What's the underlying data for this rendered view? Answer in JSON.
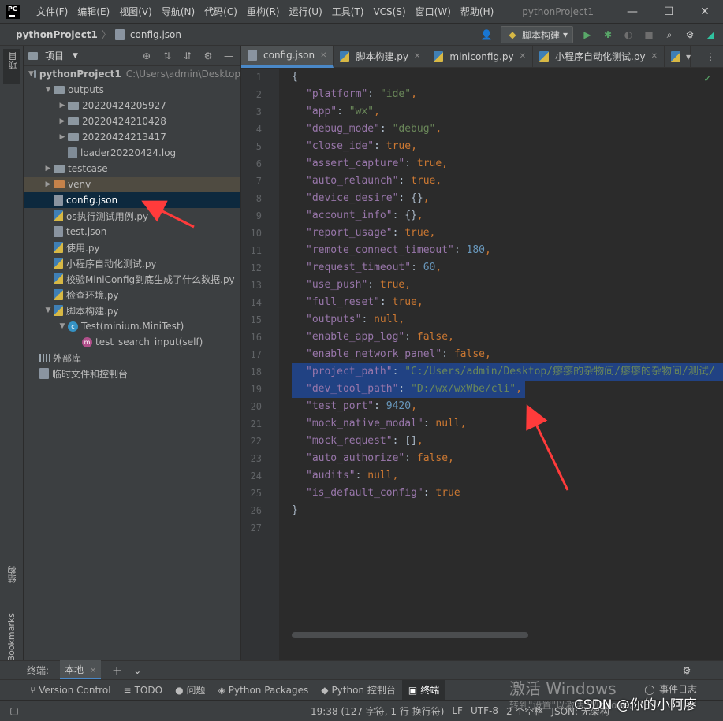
{
  "titlebar": {
    "logo": "PC",
    "menu": [
      "文件(F)",
      "编辑(E)",
      "视图(V)",
      "导航(N)",
      "代码(C)",
      "重构(R)",
      "运行(U)",
      "工具(T)",
      "VCS(S)",
      "窗口(W)",
      "帮助(H)"
    ],
    "window_title": "pythonProject1",
    "minimize": "—",
    "maximize": "☐",
    "close": "✕"
  },
  "navbar": {
    "project": "pythonProject1",
    "separator": "〉",
    "file": "config.json",
    "run_config": "脚本构建",
    "run_config_arrow": "▾"
  },
  "left_strip": {
    "project_label": "项目",
    "structure_label": "结构",
    "bookmarks_label": "Bookmarks"
  },
  "project_panel": {
    "title": "项目",
    "tree": [
      {
        "label": "pythonProject1",
        "hint": "C:\\Users\\admin\\Desktop",
        "depth": 0,
        "type": "folder",
        "expanded": true,
        "bold": true
      },
      {
        "label": "outputs",
        "depth": 1,
        "type": "folder",
        "expanded": true
      },
      {
        "label": "20220424205927",
        "depth": 2,
        "type": "folder",
        "expanded": false
      },
      {
        "label": "20220424210428",
        "depth": 2,
        "type": "folder",
        "expanded": false
      },
      {
        "label": "20220424213417",
        "depth": 2,
        "type": "folder",
        "expanded": false
      },
      {
        "label": "loader20220424.log",
        "depth": 2,
        "type": "file"
      },
      {
        "label": "testcase",
        "depth": 1,
        "type": "folder",
        "expanded": false
      },
      {
        "label": "venv",
        "depth": 1,
        "type": "folder-orange",
        "expanded": false,
        "highlight": true
      },
      {
        "label": "config.json",
        "depth": 1,
        "type": "json",
        "selected": true
      },
      {
        "label": "os执行测试用例.py",
        "depth": 1,
        "type": "py"
      },
      {
        "label": "test.json",
        "depth": 1,
        "type": "json"
      },
      {
        "label": "使用.py",
        "depth": 1,
        "type": "py"
      },
      {
        "label": "小程序自动化测试.py",
        "depth": 1,
        "type": "py"
      },
      {
        "label": "校验MiniConfig到底生成了什么数据.py",
        "depth": 1,
        "type": "py"
      },
      {
        "label": "检查环境.py",
        "depth": 1,
        "type": "py"
      },
      {
        "label": "脚本构建.py",
        "depth": 1,
        "type": "py",
        "expanded": true
      },
      {
        "label": "Test(minium.MiniTest)",
        "depth": 2,
        "type": "class",
        "expanded": true
      },
      {
        "label": "test_search_input(self)",
        "depth": 3,
        "type": "method"
      },
      {
        "label": "外部库",
        "depth": 0,
        "type": "lib"
      },
      {
        "label": "临时文件和控制台",
        "depth": 0,
        "type": "scratch"
      }
    ]
  },
  "tabs": [
    {
      "label": "config.json",
      "active": true,
      "type": "json"
    },
    {
      "label": "脚本构建.py",
      "active": false,
      "type": "py"
    },
    {
      "label": "miniconfig.py",
      "active": false,
      "type": "py"
    },
    {
      "label": "小程序自动化测试.py",
      "active": false,
      "type": "py"
    }
  ],
  "editor": {
    "lines": [
      {
        "n": "1",
        "text": "{"
      },
      {
        "n": "2",
        "key": "platform",
        "val": "\"ide\"",
        "kind": "s"
      },
      {
        "n": "3",
        "key": "app",
        "val": "\"wx\"",
        "kind": "s"
      },
      {
        "n": "4",
        "key": "debug_mode",
        "val": "\"debug\"",
        "kind": "s"
      },
      {
        "n": "5",
        "key": "close_ide",
        "val": "true",
        "kind": "b"
      },
      {
        "n": "6",
        "key": "assert_capture",
        "val": "true",
        "kind": "b"
      },
      {
        "n": "7",
        "key": "auto_relaunch",
        "val": "true",
        "kind": "b"
      },
      {
        "n": "8",
        "key": "device_desire",
        "val": "{}",
        "kind": "p"
      },
      {
        "n": "9",
        "key": "account_info",
        "val": "{}",
        "kind": "p"
      },
      {
        "n": "10",
        "key": "report_usage",
        "val": "true",
        "kind": "b"
      },
      {
        "n": "11",
        "key": "remote_connect_timeout",
        "val": "180",
        "kind": "n"
      },
      {
        "n": "12",
        "key": "request_timeout",
        "val": "60",
        "kind": "n"
      },
      {
        "n": "13",
        "key": "use_push",
        "val": "true",
        "kind": "b"
      },
      {
        "n": "14",
        "key": "full_reset",
        "val": "true",
        "kind": "b"
      },
      {
        "n": "15",
        "key": "outputs",
        "val": "null",
        "kind": "b"
      },
      {
        "n": "16",
        "key": "enable_app_log",
        "val": "false",
        "kind": "b"
      },
      {
        "n": "17",
        "key": "enable_network_panel",
        "val": "false",
        "kind": "b"
      },
      {
        "n": "18",
        "key": "project_path",
        "val": "\"C:/Users/admin/Desktop/瘳瘳的杂物间/瘳瘳的杂物间/测试/",
        "kind": "s",
        "selected": true,
        "noComma": true
      },
      {
        "n": "19",
        "key": "dev_tool_path",
        "val": "\"D:/wx/wxWbe/cli\"",
        "kind": "s",
        "selected": true
      },
      {
        "n": "20",
        "key": "test_port",
        "val": "9420",
        "kind": "n"
      },
      {
        "n": "21",
        "key": "mock_native_modal",
        "val": "null",
        "kind": "b"
      },
      {
        "n": "22",
        "key": "mock_request",
        "val": "[]",
        "kind": "p"
      },
      {
        "n": "23",
        "key": "auto_authorize",
        "val": "false",
        "kind": "b"
      },
      {
        "n": "24",
        "key": "audits",
        "val": "null",
        "kind": "b"
      },
      {
        "n": "25",
        "key": "is_default_config",
        "val": "true",
        "kind": "b",
        "noComma": true
      },
      {
        "n": "26",
        "text": "}"
      },
      {
        "n": "27",
        "text": ""
      }
    ]
  },
  "terminal": {
    "label": "终端:",
    "tab": "本地"
  },
  "toolbar": [
    {
      "label": "Version Control",
      "icon": "⑂"
    },
    {
      "label": "TODO",
      "icon": "≡"
    },
    {
      "label": "问题",
      "icon": "●"
    },
    {
      "label": "Python Packages",
      "icon": "◈"
    },
    {
      "label": "Python 控制台",
      "icon": "◆"
    },
    {
      "label": "终端",
      "icon": "▣",
      "active": true
    }
  ],
  "status": {
    "position": "19:38 (127 字符, 1 行 换行符)",
    "line_sep": "LF",
    "encoding": "UTF-8",
    "indent": "2 个空格",
    "schema": "JSON: 无架构",
    "event_log": "事件日志"
  },
  "overlay": {
    "activate": "激活 Windows",
    "activate_sub": "转到\"设置\"以激活 Windows。",
    "watermark": "CSDN @你的小阿廖"
  },
  "colors": {
    "selection": "#214283",
    "tree_selected": "#0d293e",
    "arrow": "#ff3b3b"
  }
}
